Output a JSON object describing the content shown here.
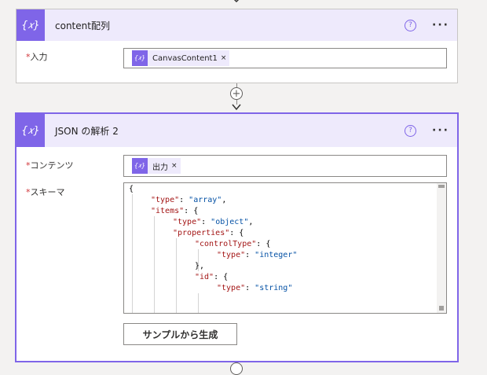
{
  "colors": {
    "accent": "#7f65e8",
    "header_bg": "#eeeafc",
    "required": "#d13438"
  },
  "card1": {
    "icon": "{𝑥}",
    "title": "content配列",
    "help": "?",
    "more": "···",
    "input_label": "入力",
    "required_mark": "*",
    "token_text": "CanvasContent1",
    "token_remove": "×"
  },
  "card2": {
    "icon": "{𝑥}",
    "title": "JSON の解析 2",
    "help": "?",
    "more": "···",
    "content_label": "コンテンツ",
    "schema_label": "スキーマ",
    "required_mark": "*",
    "token_text": "出力",
    "token_remove": "×",
    "generate_button": "サンプルから生成",
    "code": {
      "l1": "{",
      "l2_key": "\"type\"",
      "l2_val": "\"array\"",
      "l3_key": "\"items\"",
      "l4_key": "\"type\"",
      "l4_val": "\"object\"",
      "l5_key": "\"properties\"",
      "l6_key": "\"controlType\"",
      "l7_key": "\"type\"",
      "l7_val": "\"integer\"",
      "l8": "},",
      "l9_key": "\"id\"",
      "l10_key": "\"type\"",
      "l10_val": "\"string\""
    }
  },
  "icons": [
    "variable-icon",
    "help-icon",
    "more-icon",
    "plus-icon",
    "arrow-down-icon",
    "remove-icon"
  ]
}
